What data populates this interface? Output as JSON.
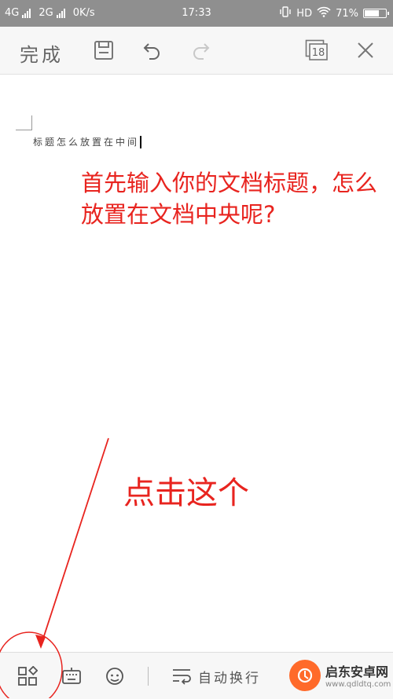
{
  "status_bar": {
    "network_1": "4G",
    "network_2": "2G",
    "speed": "0K/s",
    "time": "17:33",
    "hd": "HD",
    "battery": "71%",
    "battery_level": 0.71
  },
  "toolbar": {
    "done_label": "完成",
    "page_count": "18"
  },
  "document": {
    "text": "标题怎么放置在中间"
  },
  "annotations": {
    "top_note": "首先输入你的文档标题，怎么放置在文档中央呢?",
    "click_note": "点击这个",
    "color": "#e8241f"
  },
  "bottom_bar": {
    "wrap_label": "自动换行"
  },
  "watermark": {
    "title": "启东安卓网",
    "url": "www.qdldtq.com"
  },
  "icons": {
    "save": "save-icon",
    "undo": "undo-icon",
    "redo": "redo-icon",
    "pages": "pages-icon",
    "close": "close-icon",
    "tools": "tools-grid-icon",
    "keyboard": "keyboard-icon",
    "voice": "voice-assistant-icon",
    "wrap": "text-wrap-icon"
  }
}
